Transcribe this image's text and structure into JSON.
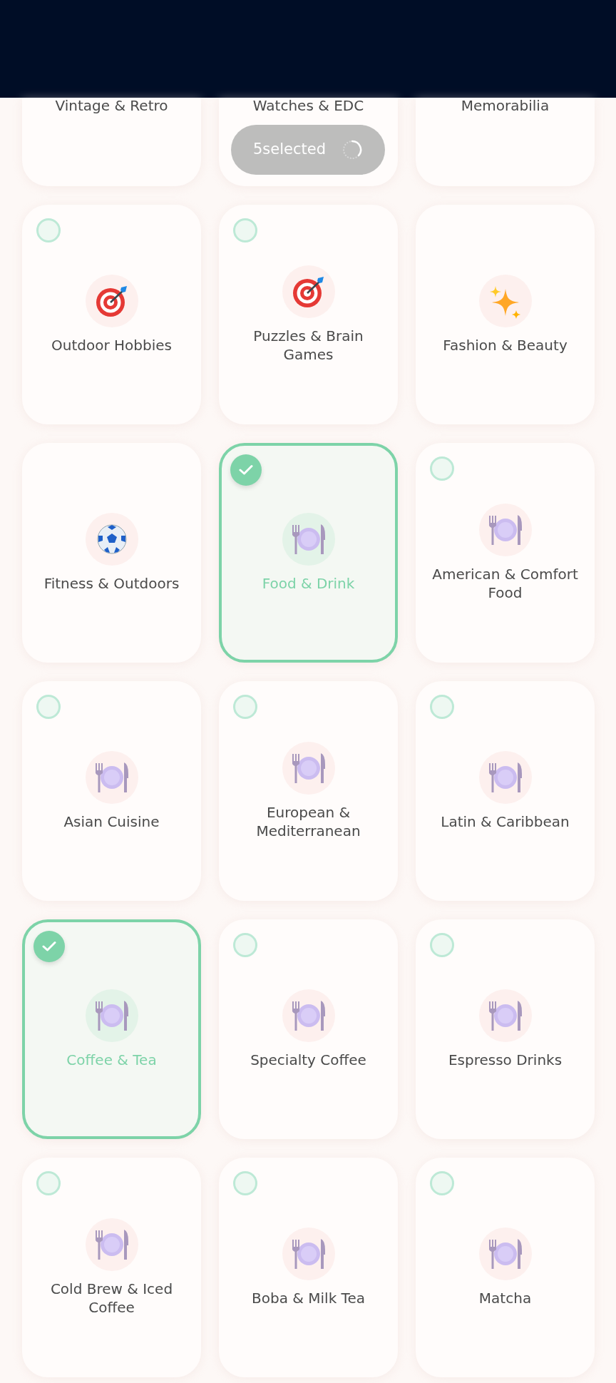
{
  "selection_toast": {
    "label": "5selected"
  },
  "categories": [
    {
      "label": "Vintage & Retro",
      "selected": false,
      "kind": "cut"
    },
    {
      "label": "Watches & EDC",
      "selected": false,
      "kind": "cut"
    },
    {
      "label": "Memorabilia",
      "selected": false,
      "kind": "cut"
    },
    {
      "label": "Outdoor Hobbies",
      "selected": false,
      "kind": "target"
    },
    {
      "label": "Puzzles & Brain Games",
      "selected": false,
      "kind": "target"
    },
    {
      "label": "Fashion & Beauty",
      "kind": "sparkles"
    },
    {
      "label": "Fitness & Outdoors",
      "kind": "ball"
    },
    {
      "label": "Food & Drink",
      "selected": true,
      "kind": "plate"
    },
    {
      "label": "American & Comfort Food",
      "selected": false,
      "kind": "plate"
    },
    {
      "label": "Asian Cuisine",
      "selected": false,
      "kind": "plate"
    },
    {
      "label": "European & Mediterranean",
      "selected": false,
      "kind": "plate"
    },
    {
      "label": "Latin & Caribbean",
      "selected": false,
      "kind": "plate"
    },
    {
      "label": "Coffee & Tea",
      "selected": true,
      "kind": "plate"
    },
    {
      "label": "Specialty Coffee",
      "selected": false,
      "kind": "plate"
    },
    {
      "label": "Espresso Drinks",
      "selected": false,
      "kind": "plate"
    },
    {
      "label": "Cold Brew & Iced Coffee",
      "selected": false,
      "kind": "plate"
    },
    {
      "label": "Boba & Milk Tea",
      "selected": false,
      "kind": "plate"
    },
    {
      "label": "Matcha",
      "selected": false,
      "kind": "plate"
    }
  ]
}
